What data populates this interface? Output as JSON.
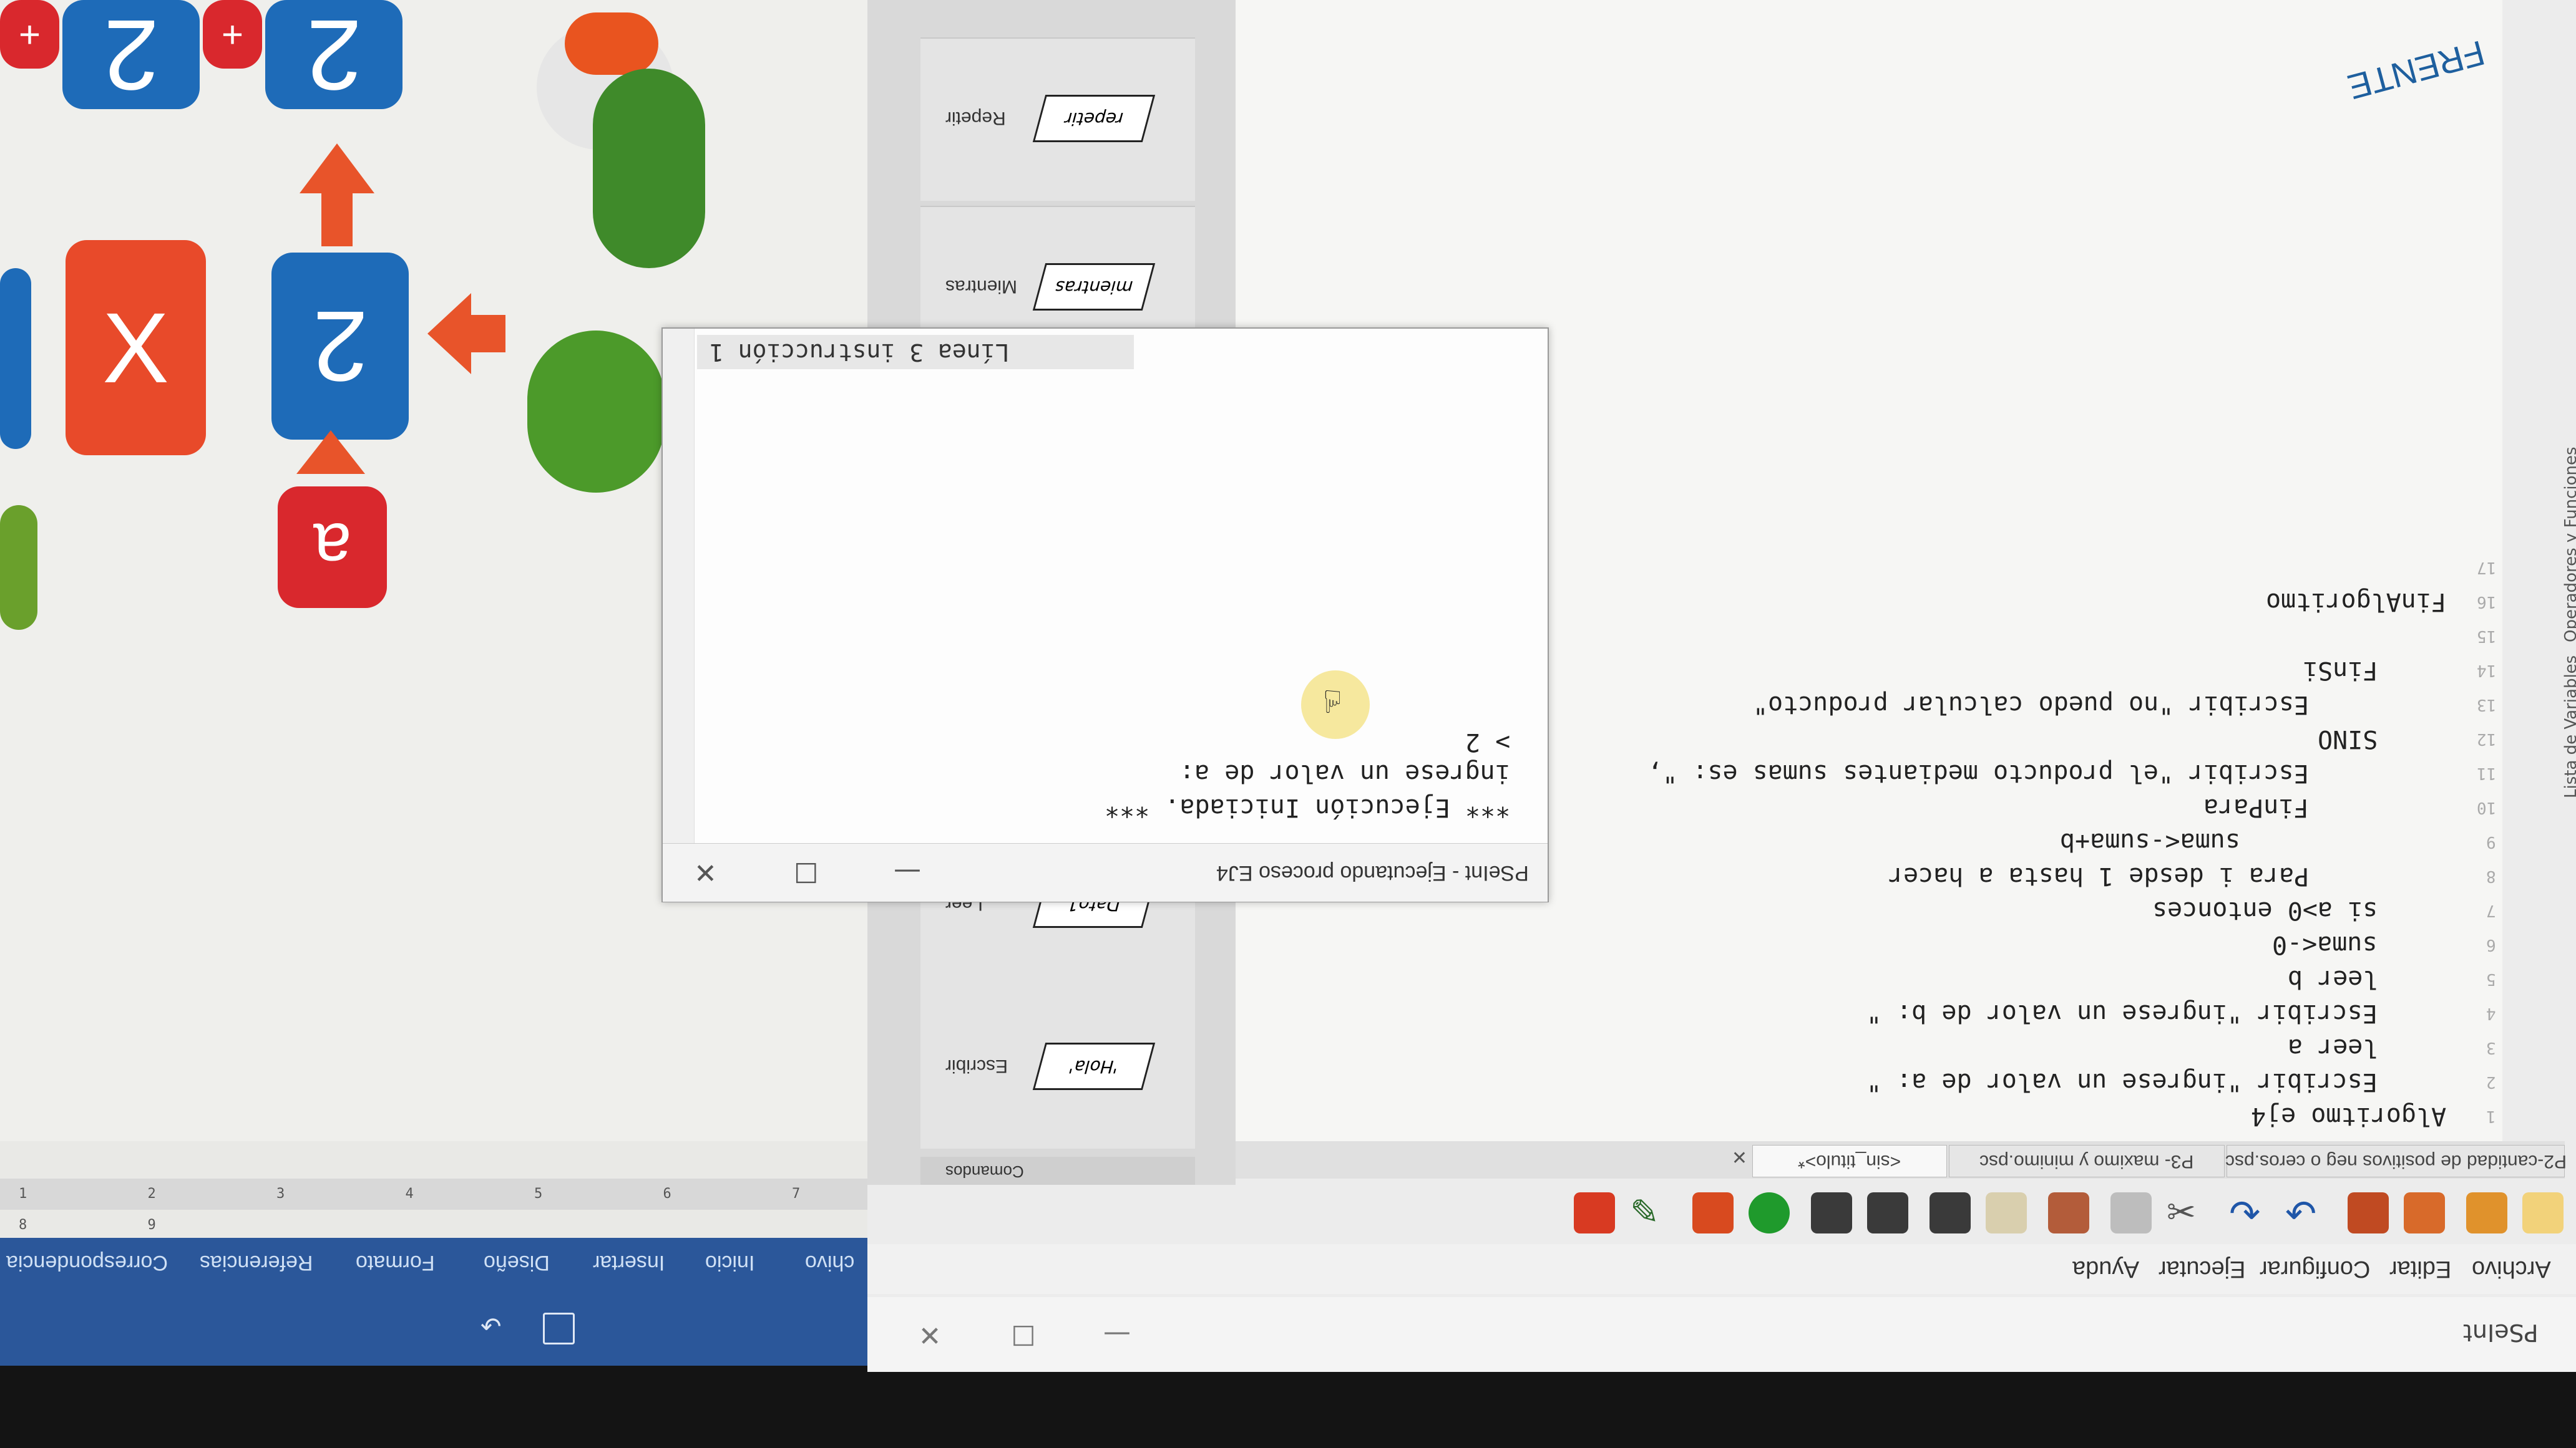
{
  "background_doc": {
    "tiles": [
      "2",
      "2",
      "X",
      "2",
      "a",
      "+",
      "+"
    ],
    "ribbon_tabs": [
      "chivo",
      "Inicio",
      "Insertar",
      "Diseño",
      "Formato",
      "Referencias",
      "Correspondencia"
    ],
    "ruler_numbers": "1 2 3 4 5 6 7 8 9"
  },
  "pseint": {
    "title": "PSeInt",
    "menu": [
      "Archivo",
      "Editar",
      "Configurar",
      "Ejecutar",
      "Ayuda"
    ],
    "tabs": [
      "P2-cantidad de positivos neg o ceros.psc",
      "P3- maximo y minimo.psc",
      "<sin_titulo>*"
    ],
    "commands_header": "Comandos",
    "commands": [
      {
        "label": "Escribir",
        "shape_text": "'Hola'"
      },
      {
        "label": "Leer",
        "shape_text": "Dato1"
      },
      {
        "label": "Mientras",
        "shape_text": "mientras"
      },
      {
        "label": "Repetir",
        "shape_text": "repetir"
      }
    ],
    "side_panel": [
      "Lista de Variables",
      "Operadores y Funciones"
    ],
    "code_lines": [
      {
        "n": "1",
        "text": "Algoritmo ej4"
      },
      {
        "n": "2",
        "text": "Escribir \"ingrese un valor de a: \""
      },
      {
        "n": "3",
        "text": "leer a"
      },
      {
        "n": "4",
        "text": "Escribir \"ingrese un valor de b: \""
      },
      {
        "n": "5",
        "text": "leer b"
      },
      {
        "n": "6",
        "text": "suma<-0"
      },
      {
        "n": "7",
        "text": "si a>0 entonces"
      },
      {
        "n": "8",
        "text": "Para i desde 1 hasta a hacer"
      },
      {
        "n": "9",
        "text": "suma<-suma+b"
      },
      {
        "n": "10",
        "text": "FinPara"
      },
      {
        "n": "11",
        "text": "Escribir \"el producto mediantes sumas es: \", "
      },
      {
        "n": "12",
        "text": "SINO"
      },
      {
        "n": "13",
        "text": "Escribir \"no puedo calcular producto\""
      },
      {
        "n": "14",
        "text": "FinSi"
      },
      {
        "n": "15",
        "text": ""
      },
      {
        "n": "16",
        "text": "FinAlgoritmo"
      },
      {
        "n": "17",
        "text": ""
      }
    ]
  },
  "exec_window": {
    "title": "PSeInt - Ejecutando proceso EJ4",
    "lines": [
      "*** Ejecución Iniciada. ***",
      "ingrese un valor de a:",
      "> 2"
    ],
    "status": "Línea 3 instrucción 1"
  },
  "logo_text": "FRENTE"
}
